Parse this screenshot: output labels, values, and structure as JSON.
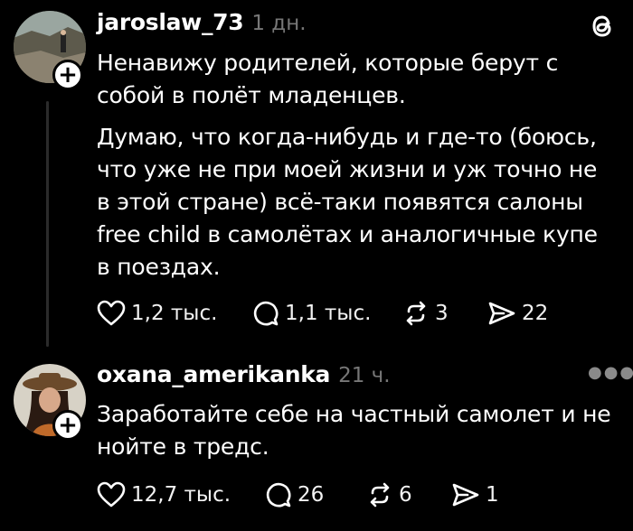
{
  "posts": [
    {
      "username": "jaroslaw_73",
      "time": "1 дн.",
      "paragraphs": [
        "Ненавижу родителей, которые берут с собой в полёт младенцев.",
        "Думаю, что когда-нибудь и где-то (боюсь, что уже не при моей жизни и уж точно не в этой стране) всё-таки появятся салоны free child в самолётах и аналогичные купе в поездах."
      ],
      "likes": "1,2 тыс.",
      "comments": "1,1 тыс.",
      "reposts": "3",
      "shares": "22"
    },
    {
      "username": "oxana_amerikanka",
      "time": "21 ч.",
      "paragraphs": [
        "Заработайте себе на частный самолет и не нойте в тредс."
      ],
      "likes": "12,7 тыс.",
      "comments": "26",
      "reposts": "6",
      "shares": "1"
    }
  ],
  "icons": {
    "app_logo": "threads-logo-icon",
    "more": "more-dots-icon"
  }
}
